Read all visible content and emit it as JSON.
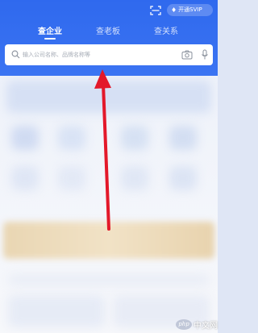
{
  "header": {
    "vip_label": "开通SVIP",
    "tabs": [
      {
        "label": "查企业",
        "active": true
      },
      {
        "label": "查老板",
        "active": false
      },
      {
        "label": "查关系",
        "active": false
      }
    ],
    "search": {
      "placeholder": "输入公司名称、品牌名称等"
    },
    "colors": {
      "brand": "#2f69ee",
      "arrow": "#e3182a",
      "banner": "#ecd9b8"
    },
    "icons": [
      "scan-icon",
      "diamond-icon",
      "search-icon",
      "camera-icon",
      "mic-icon"
    ]
  },
  "watermark": {
    "logo_text": "php",
    "text": "中文网"
  }
}
